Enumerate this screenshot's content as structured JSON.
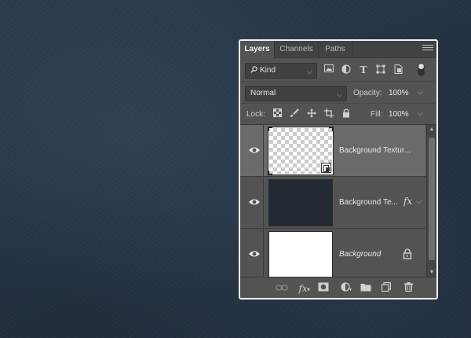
{
  "tabs": [
    {
      "label": "Layers",
      "active": true
    },
    {
      "label": "Channels",
      "active": false
    },
    {
      "label": "Paths",
      "active": false
    }
  ],
  "filter": {
    "kind_label": "Kind",
    "icons": [
      "image-filter-icon",
      "adjustment-filter-icon",
      "type-filter-icon",
      "shape-filter-icon",
      "smart-object-filter-icon"
    ]
  },
  "blend": {
    "mode": "Normal",
    "opacity_label": "Opacity:",
    "opacity_value": "100%"
  },
  "lock": {
    "label": "Lock:",
    "fill_label": "Fill:",
    "fill_value": "100%"
  },
  "layers": [
    {
      "name": "Background Textur...",
      "thumb": "checker",
      "selected": true,
      "visible": true
    },
    {
      "name": "Background Te...",
      "thumb": "dark",
      "selected": false,
      "visible": true,
      "fx": "fx"
    },
    {
      "name": "Background",
      "thumb": "white",
      "selected": false,
      "visible": true,
      "locked": true
    }
  ],
  "colors": {
    "panel": "#535353",
    "selected_row": "#6a6a6a",
    "tab_bar": "#424242",
    "background": "#243142"
  }
}
